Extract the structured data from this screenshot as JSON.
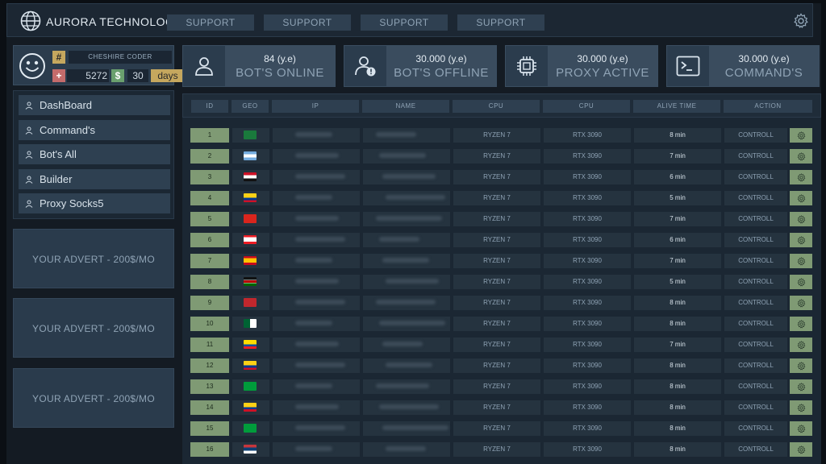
{
  "brand": {
    "title": "AURORA TECHNOLOGY"
  },
  "topnav": {
    "buttons": [
      "SUPPORT",
      "SUPPORT",
      "SUPPORT",
      "SUPPORT"
    ]
  },
  "profile": {
    "hash": "#",
    "name": "CHESHIRE CODER",
    "plus": "+",
    "count": "5272",
    "dollar": "$",
    "days_num": "30",
    "days_label": "days"
  },
  "nav": {
    "items": [
      "DashBoard",
      "Command's",
      "Bot's All",
      "Builder",
      "Proxy Socks5"
    ]
  },
  "adverts": [
    "YOUR ADVERT - 200$/MO",
    "YOUR ADVERT - 200$/MO",
    "YOUR ADVERT - 200$/MO"
  ],
  "stats": [
    {
      "value": "84 (y.e)",
      "label": "BOT'S ONLINE",
      "icon": "user-icon"
    },
    {
      "value": "30.000 (y.e)",
      "label": "BOT'S OFFLINE",
      "icon": "user-alert-icon"
    },
    {
      "value": "30.000 (y.e)",
      "label": "PROXY ACTIVE",
      "icon": "cpu-chip-icon"
    },
    {
      "value": "30.000 (y.e)",
      "label": "COMMAND'S",
      "icon": "terminal-icon"
    }
  ],
  "table": {
    "headers": [
      "ID",
      "GEO",
      "IP",
      "NAME",
      "CPU",
      "CPU",
      "ALIVE TIME",
      "ACTION"
    ],
    "rows": [
      {
        "id": "1",
        "geo": "Bangladesh",
        "cpu": "RYZEN 7",
        "gpu": "RTX 3090",
        "alive": "8 min",
        "action": "CONTROLL"
      },
      {
        "id": "2",
        "geo": "Argentina",
        "cpu": "RYZEN 7",
        "gpu": "RTX 3090",
        "alive": "7 min",
        "action": "CONTROLL"
      },
      {
        "id": "3",
        "geo": "Egypt",
        "cpu": "RYZEN 7",
        "gpu": "RTX 3090",
        "alive": "6 min",
        "action": "CONTROLL"
      },
      {
        "id": "4",
        "geo": "Colombia",
        "cpu": "RYZEN 7",
        "gpu": "RTX 3090",
        "alive": "5 min",
        "action": "CONTROLL"
      },
      {
        "id": "5",
        "geo": "Vietnam",
        "cpu": "RYZEN 7",
        "gpu": "RTX 3090",
        "alive": "7 min",
        "action": "CONTROLL"
      },
      {
        "id": "6",
        "geo": "Lebanon",
        "cpu": "RYZEN 7",
        "gpu": "RTX 3090",
        "alive": "6 min",
        "action": "CONTROLL"
      },
      {
        "id": "7",
        "geo": "Spain",
        "cpu": "RYZEN 7",
        "gpu": "RTX 3090",
        "alive": "7 min",
        "action": "CONTROLL"
      },
      {
        "id": "8",
        "geo": "Kenya",
        "cpu": "RYZEN 7",
        "gpu": "RTX 3090",
        "alive": "5 min",
        "action": "CONTROLL"
      },
      {
        "id": "9",
        "geo": "Morocco",
        "cpu": "RYZEN 7",
        "gpu": "RTX 3090",
        "alive": "8 min",
        "action": "CONTROLL"
      },
      {
        "id": "10",
        "geo": "Algeria",
        "cpu": "RYZEN 7",
        "gpu": "RTX 3090",
        "alive": "8 min",
        "action": "CONTROLL"
      },
      {
        "id": "11",
        "geo": "Ecuador",
        "cpu": "RYZEN 7",
        "gpu": "RTX 3090",
        "alive": "7 min",
        "action": "CONTROLL"
      },
      {
        "id": "12",
        "geo": "Colombia",
        "cpu": "RYZEN 7",
        "gpu": "RTX 3090",
        "alive": "8 min",
        "action": "CONTROLL"
      },
      {
        "id": "13",
        "geo": "Brazil",
        "cpu": "RYZEN 7",
        "gpu": "RTX 3090",
        "alive": "8 min",
        "action": "CONTROLL"
      },
      {
        "id": "14",
        "geo": "Colombia",
        "cpu": "RYZEN 7",
        "gpu": "RTX 3090",
        "alive": "8 min",
        "action": "CONTROLL"
      },
      {
        "id": "15",
        "geo": "Brazil",
        "cpu": "RYZEN 7",
        "gpu": "RTX 3090",
        "alive": "8 min",
        "action": "CONTROLL"
      },
      {
        "id": "16",
        "geo": "Serbia",
        "cpu": "RYZEN 7",
        "gpu": "RTX 3090",
        "alive": "8 min",
        "action": "CONTROLL"
      }
    ]
  }
}
